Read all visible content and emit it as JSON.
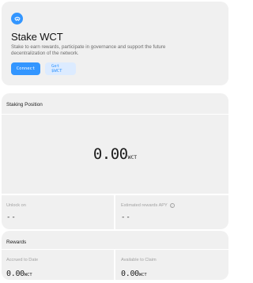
{
  "hero": {
    "title": "Stake WCT",
    "description": "Stake to earn rewards, participate in governance and support the future decentralization of the network.",
    "connect_label": "Connect",
    "get_label": "Get $WCT"
  },
  "staking": {
    "title": "Staking Position",
    "amount": "0.00",
    "unit": "WCT",
    "unlock_label": "Unlock on",
    "unlock_value": "--",
    "apy_label": "Estimated rewards APY",
    "apy_value": "--"
  },
  "rewards": {
    "title": "Rewards",
    "accrued_label": "Accrued to Date",
    "accrued_amount": "0.00",
    "accrued_unit": "WCT",
    "available_label": "Available to Claim",
    "available_amount": "0.00",
    "available_unit": "WCT"
  },
  "colors": {
    "accent": "#3396ff",
    "accent_soft": "#dcebff",
    "card_bg": "#f0f0f0"
  },
  "icons": {
    "brand": "walletconnect-logo-icon",
    "info": "info-icon"
  }
}
